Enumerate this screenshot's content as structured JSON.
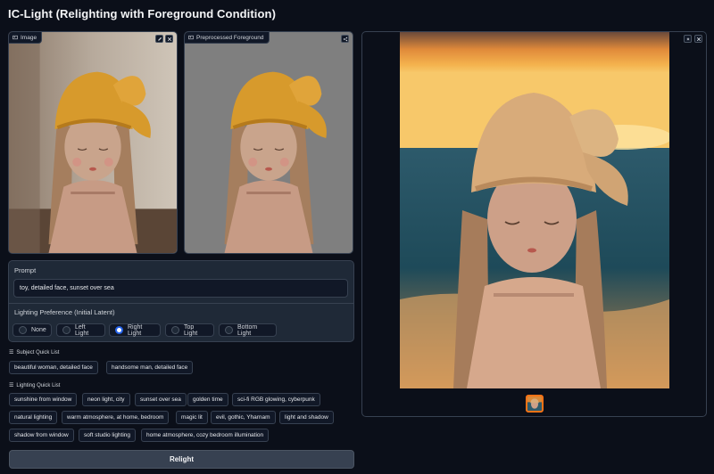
{
  "app": {
    "title": "IC-Light (Relighting with Foreground Condition)"
  },
  "image_panel": {
    "label": "Image"
  },
  "preprocessed_panel": {
    "label": "Preprocessed Foreground"
  },
  "prompt": {
    "label": "Prompt",
    "value": "toy, detailed face, sunset over sea"
  },
  "lighting": {
    "label": "Lighting Preference (Initial Latent)",
    "options": [
      "None",
      "Left Light",
      "Right Light",
      "Top Light",
      "Bottom Light"
    ],
    "selected": "Right Light"
  },
  "subject_quick_list": {
    "label": "Subject Quick List",
    "items": [
      "beautiful woman, detailed face",
      "handsome man, detailed face"
    ]
  },
  "lighting_quick_list": {
    "label": "Lighting Quick List",
    "items": [
      "sunshine from window",
      "neon light, city",
      "sunset over sea",
      "golden time",
      "sci-fi RGB glowing, cyberpunk",
      "natural lighting",
      "warm atmosphere, at home, bedroom",
      "magic lit",
      "evil, gothic, Yharnam",
      "light and shadow",
      "shadow from window",
      "soft studio lighting",
      "home atmosphere, cozy bedroom illumination"
    ]
  },
  "relight_button": {
    "label": "Relight"
  },
  "colors": {
    "background": "#0b0f19",
    "panel": "#1f2937",
    "border": "#374151",
    "accent_blue": "#2563eb",
    "thumb_border": "#f97316"
  }
}
